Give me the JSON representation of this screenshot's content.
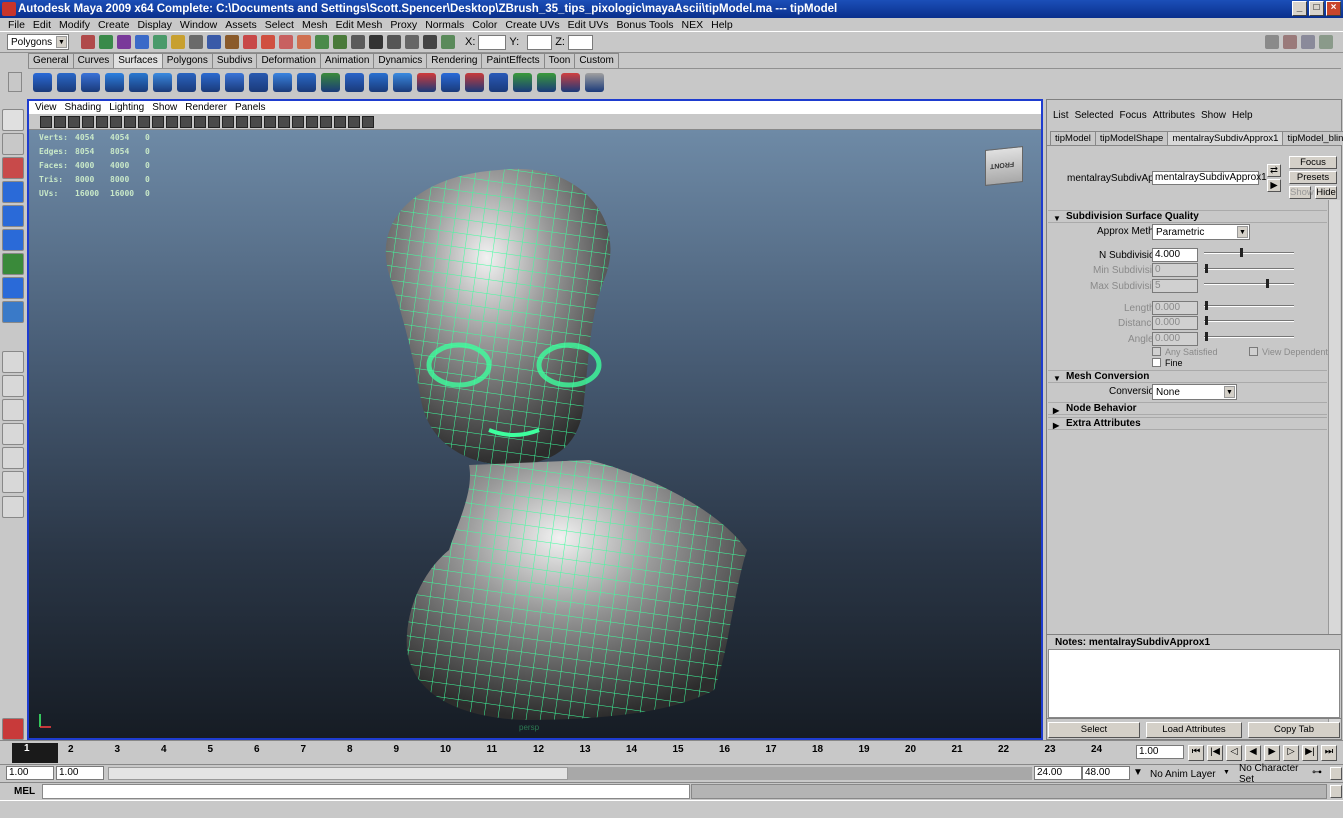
{
  "window": {
    "title": "Autodesk Maya 2009 x64 Complete: C:\\Documents and Settings\\Scott.Spencer\\Desktop\\ZBrush_35_tips_pixologic\\mayaAscii\\tipModel.ma   ---   tipModel"
  },
  "menubar": [
    "File",
    "Edit",
    "Modify",
    "Create",
    "Display",
    "Window",
    "Assets",
    "Select",
    "Mesh",
    "Edit Mesh",
    "Proxy",
    "Normals",
    "Color",
    "Create UVs",
    "Edit UVs",
    "Bonus Tools",
    "NEX",
    "Help"
  ],
  "statusline": {
    "mode": "Polygons",
    "x_label": "X:",
    "y_label": "Y:",
    "z_label": "Z:"
  },
  "shelf_tabs": [
    "General",
    "Curves",
    "Surfaces",
    "Polygons",
    "Subdivs",
    "Deformation",
    "Animation",
    "Dynamics",
    "Rendering",
    "PaintEffects",
    "Toon",
    "Custom"
  ],
  "shelf_active": "Surfaces",
  "viewport": {
    "menu": [
      "View",
      "Shading",
      "Lighting",
      "Show",
      "Renderer",
      "Panels"
    ],
    "hud": [
      {
        "label": "Verts:",
        "a": "4054",
        "b": "4054",
        "c": "0"
      },
      {
        "label": "Edges:",
        "a": "8054",
        "b": "8054",
        "c": "0"
      },
      {
        "label": "Faces:",
        "a": "4000",
        "b": "4000",
        "c": "0"
      },
      {
        "label": "Tris:",
        "a": "8000",
        "b": "8000",
        "c": "0"
      },
      {
        "label": "UVs:",
        "a": "16000",
        "b": "16000",
        "c": "0"
      }
    ],
    "cube_label": "FRONT",
    "camera": "persp"
  },
  "attr_editor": {
    "menu": [
      "List",
      "Selected",
      "Focus",
      "Attributes",
      "Show",
      "Help"
    ],
    "tabs": [
      "tipModel",
      "tipModelShape",
      "mentalraySubdivApprox1",
      "tipModel_blinn"
    ],
    "active_tab": "mentalraySubdivApprox1",
    "node_label": "mentalraySubdivApprox:",
    "node_value": "mentalraySubdivApprox1",
    "focus": "Focus",
    "presets": "Presets",
    "show": "Show",
    "hide": "Hide",
    "section1": "Subdivision Surface Quality",
    "approx_label": "Approx Method",
    "approx_value": "Parametric",
    "n_sub_label": "N Subdivisions",
    "n_sub_value": "4.000",
    "min_sub_label": "Min Subdivisions",
    "min_sub_value": "0",
    "max_sub_label": "Max Subdivisions",
    "max_sub_value": "5",
    "length_label": "Length",
    "length_value": "0.000",
    "distance_label": "Distance",
    "distance_value": "0.000",
    "angle_label": "Angle",
    "angle_value": "0.000",
    "any_satisfied": "Any Satisfied",
    "view_dependent": "View Dependent",
    "fine": "Fine",
    "section2": "Mesh Conversion",
    "conversion_label": "Conversion",
    "conversion_value": "None",
    "section3": "Node Behavior",
    "section4": "Extra Attributes",
    "notes_label": "Notes:  mentalraySubdivApprox1",
    "buttons": [
      "Select",
      "Load Attributes",
      "Copy Tab"
    ]
  },
  "timeline": {
    "ticks": [
      "2",
      "3",
      "4",
      "5",
      "6",
      "7",
      "8",
      "9",
      "10",
      "11",
      "12",
      "13",
      "14",
      "15",
      "16",
      "17",
      "18",
      "19",
      "20",
      "21",
      "22",
      "23",
      "24"
    ],
    "current": "1",
    "current_field": "1.00"
  },
  "range": {
    "start": "1.00",
    "start2": "1.00",
    "end": "24.00",
    "end2": "48.00",
    "anim_layer": "No Anim Layer",
    "char_set": "No Character Set"
  },
  "cmd": {
    "label": "MEL"
  },
  "colors": {
    "viewport_border": "#1e3ccf",
    "wire": "#3dff9e",
    "titlebar": "#0a2f8c"
  }
}
